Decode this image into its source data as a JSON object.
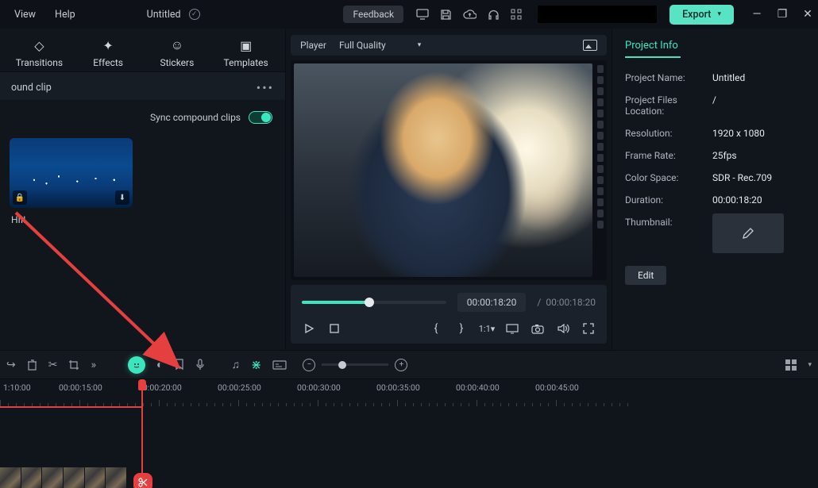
{
  "menu": {
    "view": "View",
    "help": "Help"
  },
  "title": "Untitled",
  "feedback": "Feedback",
  "export": "Export",
  "tabs": {
    "transitions": "Transitions",
    "effects": "Effects",
    "stickers": "Stickers",
    "templates": "Templates"
  },
  "clip_label": "ound clip",
  "sync_compound": "Sync compound clips",
  "thumb_name": "HIII",
  "player": {
    "label": "Player",
    "quality": "Full Quality"
  },
  "time": {
    "current": "00:00:18:20",
    "total": "00:00:18:20",
    "sep": "/"
  },
  "right": {
    "tab": "Project Info",
    "name_k": "Project Name:",
    "name_v": "Untitled",
    "loc_k": "Project Files Location:",
    "loc_v": "/",
    "res_k": "Resolution:",
    "res_v": "1920 x 1080",
    "fps_k": "Frame Rate:",
    "fps_v": "25fps",
    "cs_k": "Color Space:",
    "cs_v": "SDR - Rec.709",
    "dur_k": "Duration:",
    "dur_v": "00:00:18:20",
    "thumb_k": "Thumbnail:",
    "edit": "Edit"
  },
  "ruler": [
    "1:10:00",
    "00:00:15:00",
    "00:00:20:00",
    "00:00:25:00",
    "00:00:30:00",
    "00:00:35:00",
    "00:00:40:00",
    "00:00:45:00"
  ]
}
